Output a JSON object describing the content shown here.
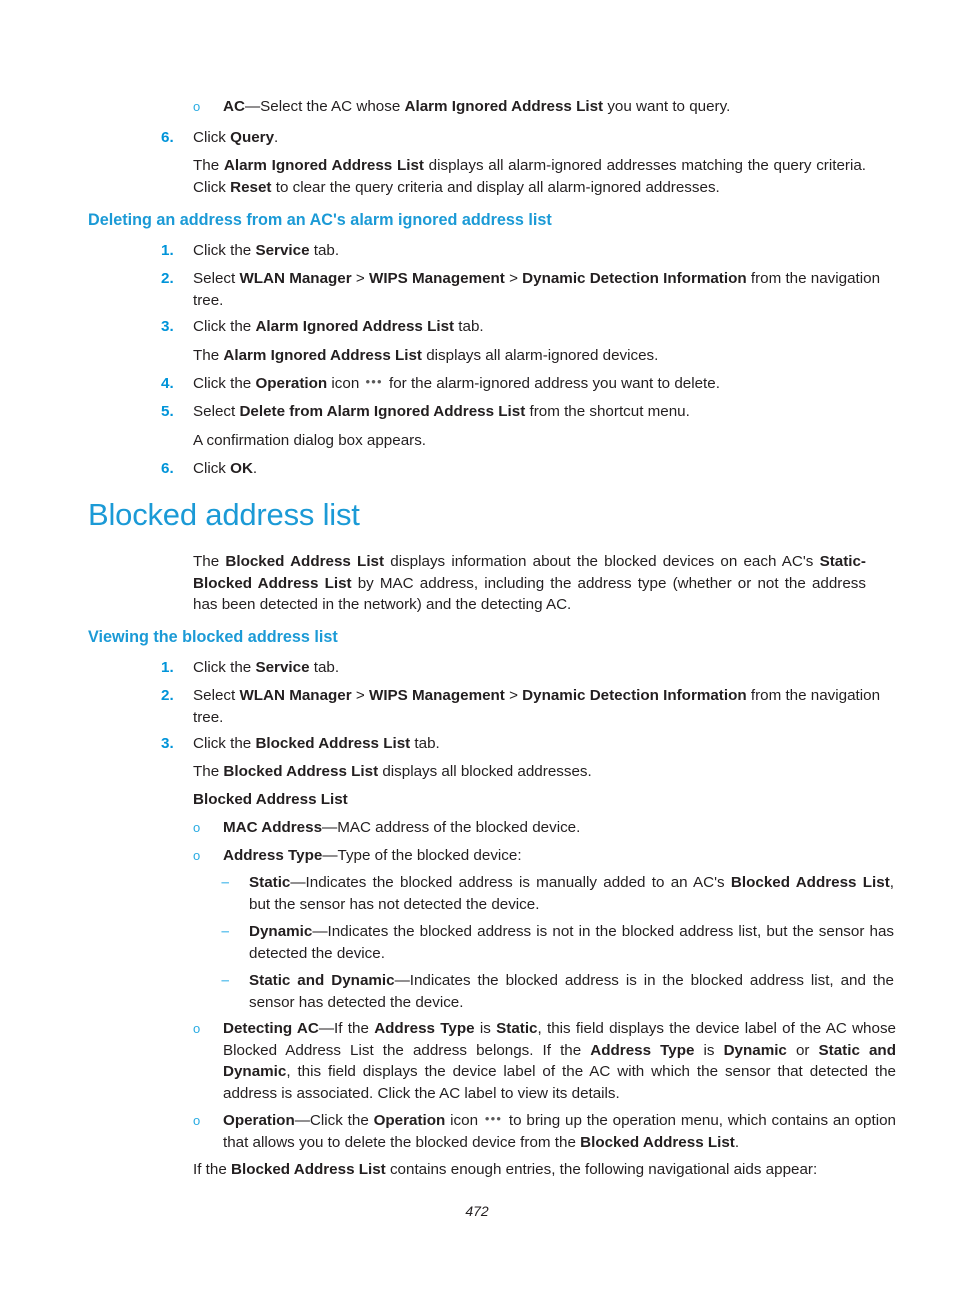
{
  "page": {
    "number": "472",
    "heading_color": "#1b9ad6",
    "marker_color": "#0094d9",
    "bullet_color": "#29abe2",
    "dash_color": "#6dc7ef",
    "text_color": "#231f20"
  },
  "top_section": {
    "ac_bullet": {
      "marker": "o",
      "term": "AC",
      "text": "—Select the AC whose ",
      "bold2": "Alarm Ignored Address List",
      "tail": " you want to query."
    },
    "step6": {
      "num": "6.",
      "pre": "Click ",
      "bold": "Query",
      "post": "."
    },
    "step6_body": {
      "pre": "The ",
      "bold1": "Alarm Ignored Address List",
      "mid1": " displays all alarm-ignored addresses matching the query criteria. Click ",
      "bold2": "Reset",
      "post": " to clear the query criteria and display all alarm-ignored addresses."
    }
  },
  "section_delete": {
    "heading": "Deleting an address from an AC's alarm ignored address list",
    "steps": [
      {
        "num": "1.",
        "pre": "Click the ",
        "bold1": "Service",
        "post": " tab."
      },
      {
        "num": "2.",
        "pre": "Select ",
        "bold1": "WLAN Manager",
        "sep1": " > ",
        "bold2": "WIPS Management",
        "sep2": " > ",
        "bold3": "Dynamic Detection Information",
        "post": " from the navigation tree."
      },
      {
        "num": "3.",
        "pre": "Click the ",
        "bold1": "Alarm Ignored Address List",
        "post": " tab."
      }
    ],
    "step3_body": {
      "pre": "The ",
      "bold1": "Alarm Ignored Address List",
      "post": " displays all alarm-ignored devices."
    },
    "step4": {
      "num": "4.",
      "pre": "Click the ",
      "bold1": "Operation",
      "mid": " icon ",
      "icon": "•••",
      "post": " for the alarm-ignored address you want to delete."
    },
    "step5": {
      "num": "5.",
      "pre": "Select ",
      "bold1": "Delete from Alarm Ignored Address List",
      "post": " from the shortcut menu."
    },
    "step5_body": "A confirmation dialog box appears.",
    "step6": {
      "num": "6.",
      "pre": "Click ",
      "bold1": "OK",
      "post": "."
    }
  },
  "section_blocked": {
    "title": "Blocked address list",
    "intro": {
      "pre": "The ",
      "bold1": "Blocked Address List",
      "mid1": " displays information about the blocked devices on each AC's ",
      "bold2": "Static-Blocked Address List",
      "post": " by MAC address, including the address type (whether or not the address has been detected in the network) and the detecting AC."
    },
    "viewing_heading": "Viewing the blocked address list",
    "steps": [
      {
        "num": "1.",
        "pre": "Click the ",
        "bold1": "Service",
        "post": " tab."
      },
      {
        "num": "2.",
        "pre": "Select ",
        "bold1": "WLAN Manager",
        "sep1": " > ",
        "bold2": "WIPS Management",
        "sep2": " > ",
        "bold3": "Dynamic Detection Information",
        "post": " from the navigation tree."
      },
      {
        "num": "3.",
        "pre": "Click the ",
        "bold1": "Blocked Address List",
        "post": " tab."
      }
    ],
    "step3_body": {
      "pre": "The ",
      "bold1": "Blocked Address List",
      "post": " displays all blocked addresses."
    },
    "field_group_label": "Blocked Address List",
    "fields": {
      "mac_address": {
        "marker": "o",
        "term": "MAC Address",
        "text": "—MAC address of the blocked device."
      },
      "address_type": {
        "marker": "o",
        "term": "Address Type",
        "text": "—Type of the blocked device:"
      },
      "address_type_values": [
        {
          "marker": "–",
          "term": "Static",
          "pre": "—Indicates the blocked address is manually added to an AC's ",
          "bold2": "Blocked Address List",
          "post": ", but the sensor has not detected the device."
        },
        {
          "marker": "–",
          "term": "Dynamic",
          "pre": "—Indicates the blocked address is not in the blocked address list, but the sensor has detected the device.",
          "bold2": "",
          "post": ""
        },
        {
          "marker": "–",
          "term": "Static and Dynamic",
          "pre": "—Indicates the blocked address is in the blocked address list, and the sensor has detected the device.",
          "bold2": "",
          "post": ""
        }
      ],
      "detecting_ac": {
        "marker": "o",
        "term": "Detecting AC",
        "p1": "—If the ",
        "b1": "Address Type",
        "p2": " is ",
        "b2": "Static",
        "p3": ", this field displays the device label of the AC whose Blocked Address List the address belongs. If the ",
        "b3": "Address Type",
        "p4": " is ",
        "b4": "Dynamic",
        "p5": " or ",
        "b5": "Static and Dynamic",
        "p6": ", this field displays the device label of the AC with which the sensor that detected the address is associated. Click the AC label to view its details."
      },
      "operation": {
        "marker": "o",
        "term": "Operation",
        "p1": "—Click the ",
        "b1": "Operation",
        "p2": " icon ",
        "icon": "•••",
        "p3": " to bring up the operation menu, which contains an option that allows you to delete the blocked device from the ",
        "b2": "Blocked Address List",
        "p4": "."
      }
    },
    "closing": {
      "pre": "If the ",
      "bold1": "Blocked Address List",
      "post": " contains enough entries, the following navigational aids appear:"
    }
  }
}
